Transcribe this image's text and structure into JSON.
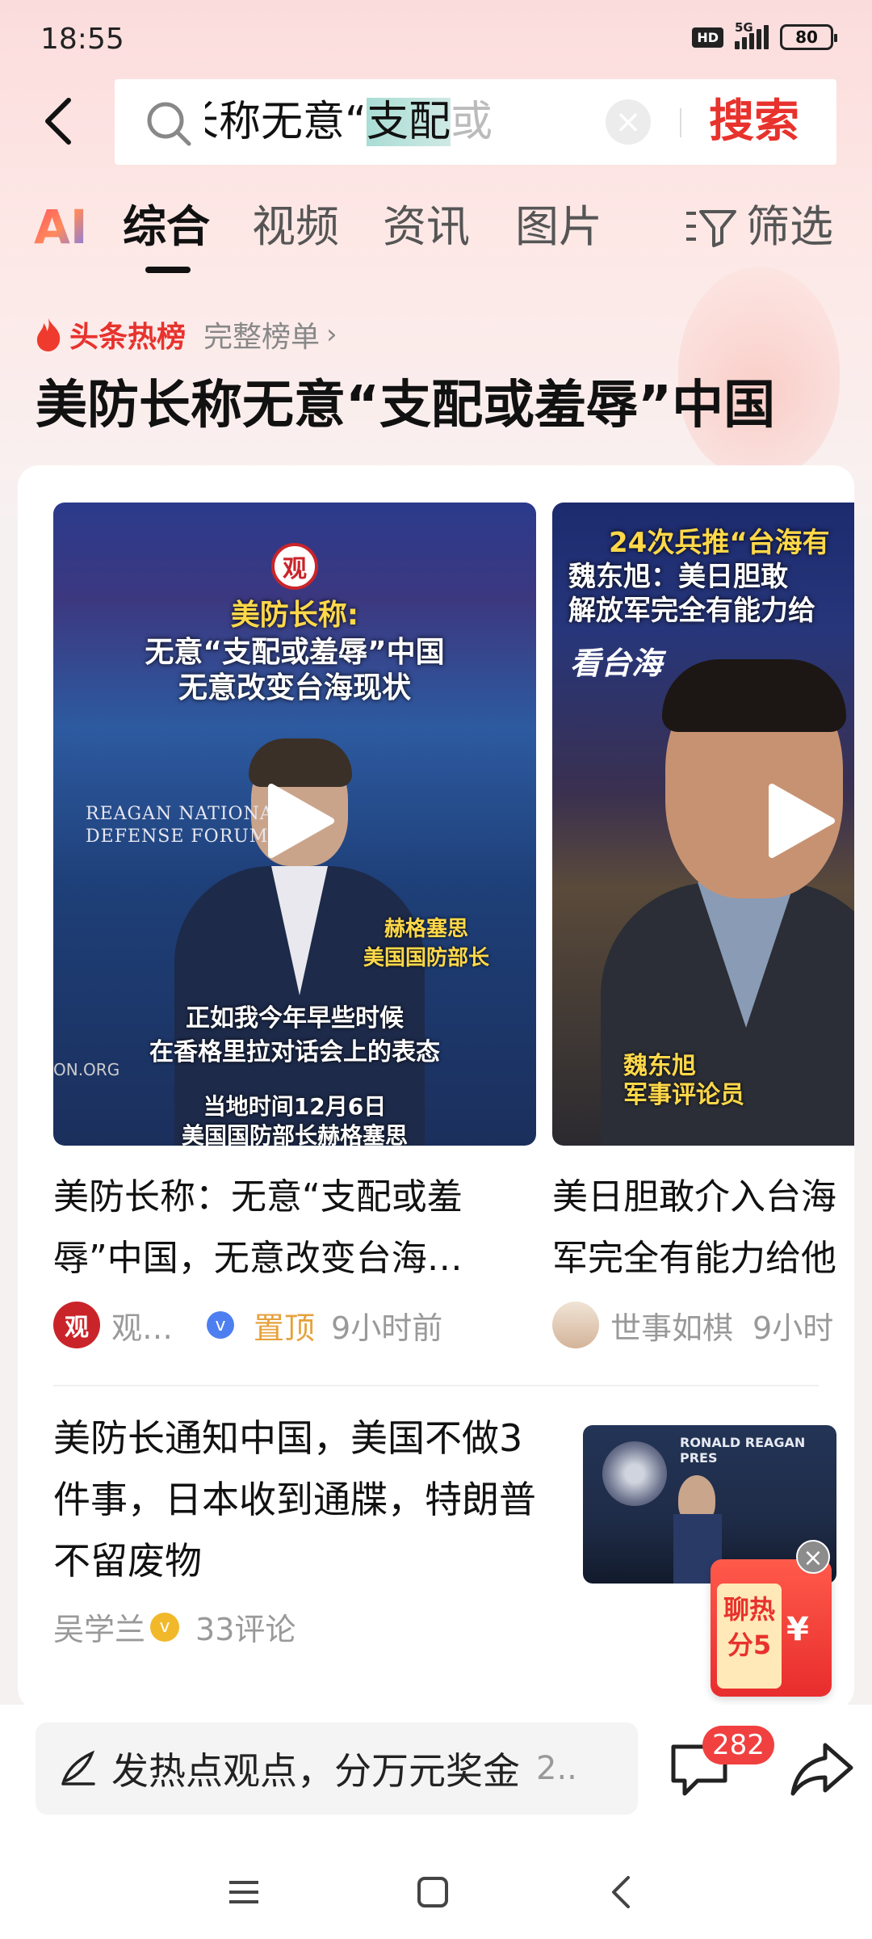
{
  "status_bar": {
    "time": "18:55",
    "hd": "HD",
    "network": "5G",
    "battery": "80"
  },
  "search": {
    "query_before_selection": "美防长称无意“",
    "query_selected": "支配",
    "query_after_selection": "或",
    "button_label": "搜索",
    "clear_glyph": "×"
  },
  "tabs": {
    "ai_label": "AI",
    "items": [
      "综合",
      "视频",
      "资讯",
      "图片"
    ],
    "active_index": 0,
    "filter_label": "筛选"
  },
  "hot": {
    "label": "头条热榜",
    "full_list_label": "完整榜单",
    "chevron": "›"
  },
  "headline": "美防长称无意“支配或羞辱”中国",
  "videos": [
    {
      "overlay_line1": "美防长称:",
      "overlay_line2": "无意“支配或羞辱”中国",
      "overlay_line3": "无意改变台海现状",
      "logo_glyph": "观",
      "forum_text": "REAGAN NATIONAL\nDEFENSE FORUM",
      "name_caption": "赫格塞思\n美国国防部长",
      "subtitle": "正如我今年早些时候\n在香格里拉对话会上的表态",
      "date_caption": "当地时间12月6日\n美国国防部长赫格塞思",
      "side_text": "ON.ORG",
      "caption_line1": "美防长称：无意“支配或羞",
      "caption_line2": "辱”中国，无意改变台海…",
      "author": "观…",
      "avatar_glyph": "观",
      "verified_glyph": "v",
      "pinned_label": "置顶",
      "time": "9小时前"
    },
    {
      "overlay_line1": "24次兵推“台海有",
      "overlay_line2": "魏东旭：美日胆敢",
      "overlay_line3": "解放军完全有能力给",
      "brand_logo": "看台海",
      "name_caption": "魏东旭\n军事评论员",
      "caption_line1": "美日胆敢介入台海",
      "caption_line2": "军完全有能力给他",
      "author": "世事如棋",
      "time": "9小时"
    }
  ],
  "article": {
    "title": "美防长通知中国，美国不做3件事，日本收到通牒，特朗普不留废物",
    "author": "吴学兰",
    "verified_glyph": "v",
    "comments": "33评论",
    "thumb_text": "RONALD REAGAN PRES"
  },
  "promo": {
    "text": "聊热\n分5",
    "currency": "¥",
    "close_glyph": "×"
  },
  "bottom": {
    "input_text": "发热点观点，分万元奖金",
    "input_suffix": "2..",
    "comment_count": "282"
  },
  "icons": {
    "back": "back-arrow-icon",
    "search": "search-icon",
    "filter": "filter-icon",
    "flame": "flame-icon",
    "play": "play-icon",
    "pen": "pen-icon",
    "comment": "comment-icon",
    "share": "share-icon",
    "menu": "menu-icon",
    "home": "home-icon",
    "nav_back": "nav-back-icon"
  },
  "colors": {
    "accent_red": "#e8322d",
    "pinned_gold": "#e6a23c",
    "verified_blue": "#4d7ff0"
  }
}
